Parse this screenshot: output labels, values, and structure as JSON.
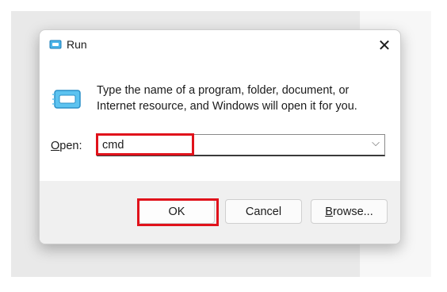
{
  "window": {
    "title": "Run",
    "close_glyph": "✕",
    "title_icon": "run-icon"
  },
  "main": {
    "icon": "run-large-icon",
    "description_line1": "Type the name of a program, folder, document, or",
    "description_line2": "Internet resource, and Windows will open it for you.",
    "open_label_mnemonic": "O",
    "open_label_rest": "pen:",
    "open_value": "cmd",
    "dropdown_glyph": "⌵"
  },
  "buttons": {
    "ok_label": "OK",
    "cancel_label": "Cancel",
    "browse_mnemonic": "B",
    "browse_rest": "rowse..."
  },
  "colors": {
    "highlight": "#e0121b",
    "footer_bg": "#f0f0f0"
  }
}
